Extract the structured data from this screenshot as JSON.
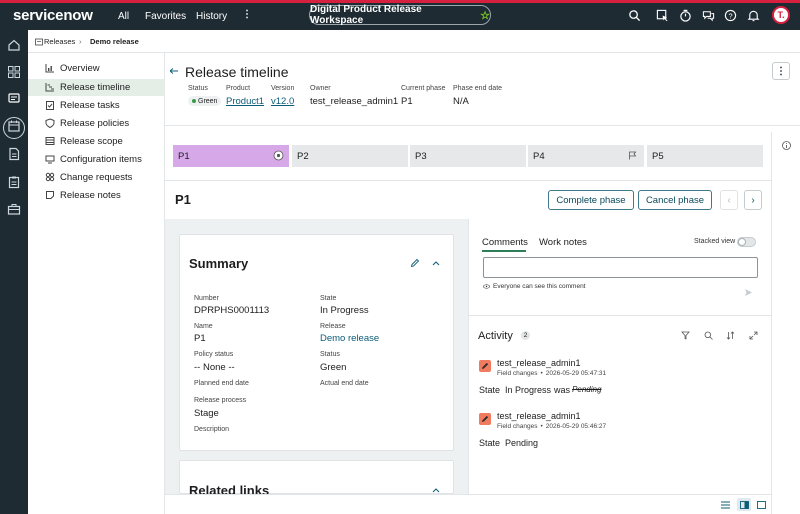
{
  "topbar": {
    "logo": "servicenow",
    "nav": [
      "All",
      "Favorites",
      "History"
    ],
    "workspace": "Digital Product Release Workspace",
    "avatar": "T."
  },
  "breadcrumb": {
    "root": "Releases",
    "current": "Demo release"
  },
  "subnav": [
    {
      "label": "Overview",
      "icon": "chart-icon"
    },
    {
      "label": "Release timeline",
      "icon": "timeline-icon"
    },
    {
      "label": "Release tasks",
      "icon": "clipboard-icon"
    },
    {
      "label": "Release policies",
      "icon": "shield-icon"
    },
    {
      "label": "Release scope",
      "icon": "list-icon"
    },
    {
      "label": "Configuration items",
      "icon": "ci-icon"
    },
    {
      "label": "Change requests",
      "icon": "change-icon"
    },
    {
      "label": "Release notes",
      "icon": "note-icon"
    }
  ],
  "header": {
    "title": "Release timeline",
    "meta": [
      {
        "label": "Status",
        "value": "Green"
      },
      {
        "label": "Product",
        "value": "Product1"
      },
      {
        "label": "Version",
        "value": "v12.0"
      },
      {
        "label": "Owner",
        "value": "test_release_admin1"
      },
      {
        "label": "Current phase",
        "value": "P1"
      },
      {
        "label": "Phase end date",
        "value": "N/A"
      }
    ]
  },
  "phases": [
    "P1",
    "P2",
    "P3",
    "P4",
    "P5"
  ],
  "phase_detail": {
    "title": "P1",
    "complete_label": "Complete phase",
    "cancel_label": "Cancel phase"
  },
  "summary": {
    "title": "Summary",
    "fields": [
      {
        "label": "Number",
        "value": "DPRPHS0001113"
      },
      {
        "label": "State",
        "value": "In Progress"
      },
      {
        "label": "Name",
        "value": "P1"
      },
      {
        "label": "Release",
        "value": "Demo release"
      },
      {
        "label": "Policy status",
        "value": "-- None --"
      },
      {
        "label": "Status",
        "value": "Green"
      },
      {
        "label": "Planned end date",
        "value": ""
      },
      {
        "label": "Actual end date",
        "value": ""
      },
      {
        "label": "Release process",
        "value": "Stage"
      },
      {
        "label": "Description",
        "value": ""
      }
    ]
  },
  "related": {
    "title": "Related links"
  },
  "comments": {
    "tab_comments": "Comments",
    "tab_worknotes": "Work notes",
    "stacked": "Stacked view",
    "visibility": "Everyone can see this comment"
  },
  "activity": {
    "title": "Activity",
    "count": "2",
    "entries": [
      {
        "user": "test_release_admin1",
        "type": "Field changes",
        "time": "2026-05-29 05:47:31",
        "field": "State",
        "value": "In Progress",
        "was_label": "was",
        "old": "Pending"
      },
      {
        "user": "test_release_admin1",
        "type": "Field changes",
        "time": "2026-05-29 05:46:27",
        "field": "State",
        "value": "Pending"
      }
    ]
  },
  "colors": {
    "topbar": "#1e2b33",
    "accent": "#d6203f",
    "phase_active": "#d6a8e8",
    "link": "#0c5d77",
    "status_green": "#3a9a4a"
  }
}
